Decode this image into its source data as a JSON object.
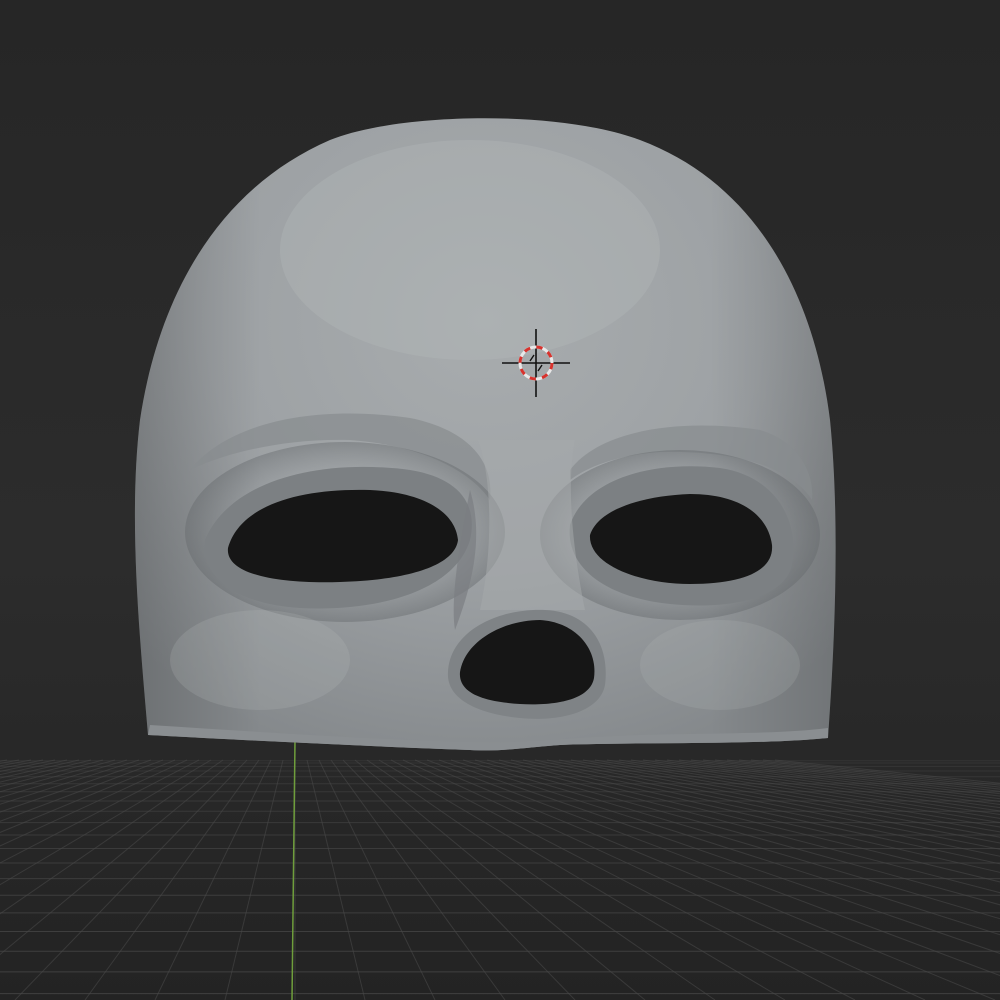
{
  "viewport": {
    "background_top": "#3c3c3c",
    "background_bottom": "#262626",
    "grid_line_color": "#484848",
    "y_axis_color": "#6f9e3c",
    "mesh_color": "#9ea2a5",
    "mesh_highlight": "#b4b8ba",
    "mesh_shadow": "#6c7073",
    "hole_color": "#161616"
  },
  "scene": {
    "object": "mask-mesh",
    "features": [
      "left-eye-hole",
      "right-eye-hole",
      "nose-hole"
    ],
    "gizmo": "3d-cursor"
  },
  "cursor": {
    "ring_color_a": "#e8e8e8",
    "ring_color_b": "#d8322d",
    "crosshair_color": "#111111"
  }
}
